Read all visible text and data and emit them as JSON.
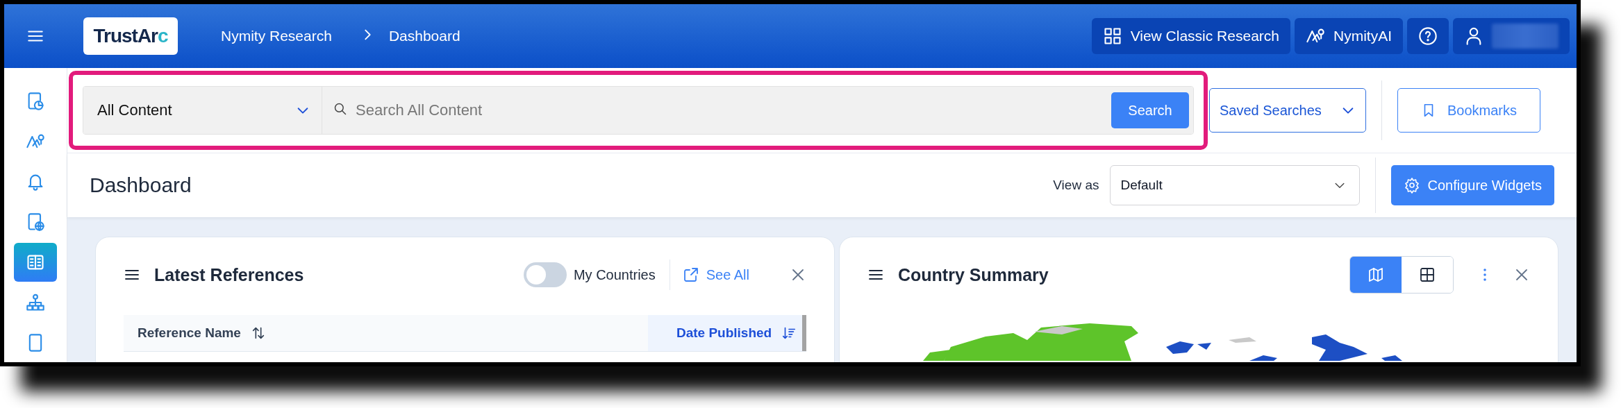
{
  "header": {
    "logo": {
      "text": "TrustAr",
      "accent": "c"
    },
    "breadcrumb": [
      "Nymity Research",
      "Dashboard"
    ],
    "actions": [
      {
        "kind": "grid",
        "label": "View Classic Research"
      },
      {
        "kind": "ai",
        "label": "NymityAI"
      },
      {
        "kind": "help"
      },
      {
        "kind": "user"
      }
    ]
  },
  "sidebar": {
    "items": [
      {
        "kind": "report",
        "selected": false
      },
      {
        "kind": "ai",
        "selected": false
      },
      {
        "kind": "bell",
        "selected": false
      },
      {
        "kind": "globe",
        "selected": false
      },
      {
        "kind": "book",
        "selected": true
      },
      {
        "kind": "tree",
        "selected": false
      },
      {
        "kind": "doc",
        "selected": false
      }
    ]
  },
  "search": {
    "highlighted": true,
    "scope": "All Content",
    "placeholder": "Search All Content",
    "button": "Search"
  },
  "saved_searches": "Saved Searches",
  "bookmarks": "Bookmarks",
  "dashboard": {
    "title": "Dashboard",
    "view_as_label": "View as",
    "view_as_value": "Default",
    "configure_button": "Configure Widgets"
  },
  "widgets": [
    {
      "title": "Latest References",
      "toggle": {
        "label": "My Countries",
        "on": false
      },
      "link": "See All",
      "table": {
        "columns": [
          {
            "label": "Reference Name",
            "sorted": false
          },
          {
            "label": "Date Published",
            "sorted": true
          }
        ]
      }
    },
    {
      "title": "Country Summary",
      "views": [
        {
          "kind": "map",
          "selected": true
        },
        {
          "kind": "table",
          "selected": false
        }
      ]
    }
  ]
}
